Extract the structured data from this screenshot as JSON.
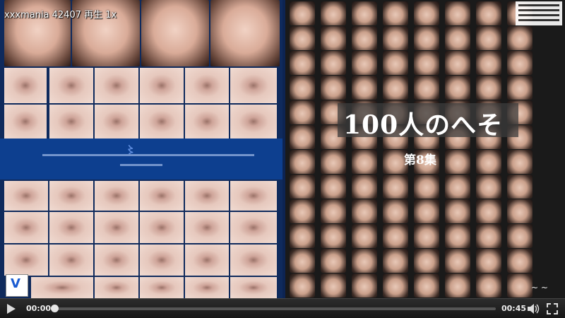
{
  "overlay": {
    "site": "xxxmania 42407 再生 1x"
  },
  "cover": {
    "title": "100人のへそ",
    "subtitle": "第8集"
  },
  "controls": {
    "current_time": "00:00",
    "total_time": "00:45",
    "progress": 0,
    "icons": {
      "play": "play-icon",
      "volume": "volume-icon",
      "fullscreen": "fullscreen-icon"
    }
  }
}
